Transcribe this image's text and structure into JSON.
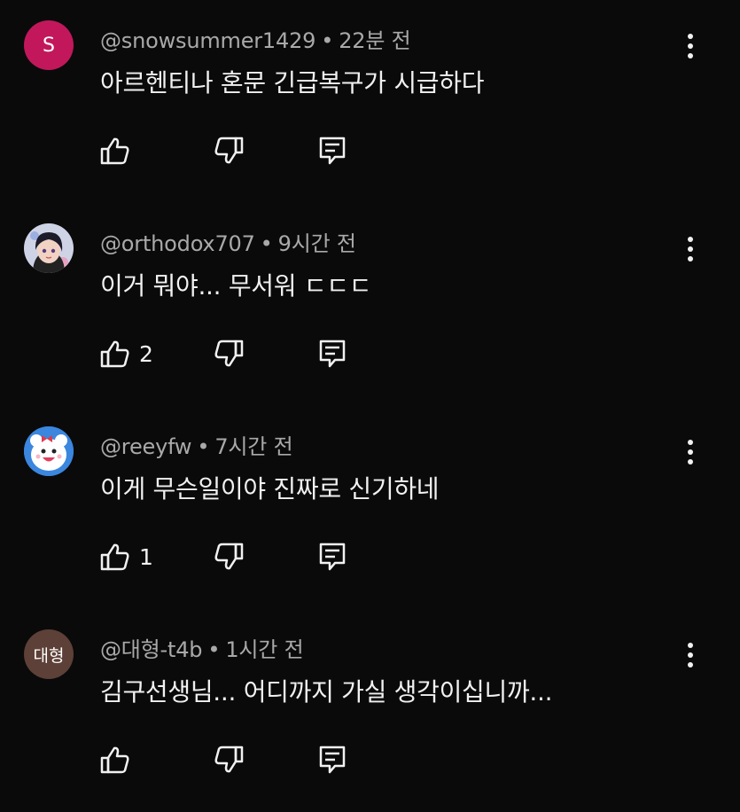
{
  "comments": [
    {
      "avatar": {
        "kind": "letter",
        "text": "S",
        "color": "#c2185b"
      },
      "author": "@snowsummer1429",
      "time": "22분 전",
      "text": "아르헨티나 혼문 긴급복구가 시급하다",
      "like_count": ""
    },
    {
      "avatar": {
        "kind": "image",
        "icon": "anime-girl-avatar"
      },
      "author": "@orthodox707",
      "time": "9시간 전",
      "text": "이거 뭐야... 무서워 ㄷㄷㄷ",
      "like_count": "2"
    },
    {
      "avatar": {
        "kind": "image",
        "icon": "cartoon-avatar"
      },
      "author": "@reeyfw",
      "time": "7시간 전",
      "text": "이게 무슨일이야 진짜로 신기하네",
      "like_count": "1"
    },
    {
      "avatar": {
        "kind": "text",
        "text": "대형",
        "color": "#5d4037"
      },
      "author": "@대형-t4b",
      "time": "1시간 전",
      "text": "김구선생님... 어디까지 가실 생각이십니까...",
      "like_count": ""
    }
  ],
  "icons": {
    "like": "thumbs-up-icon",
    "dislike": "thumbs-down-icon",
    "reply": "reply-icon",
    "more": "more-vert-icon"
  },
  "colors": {
    "background": "#0a0a0a",
    "text_primary": "#f1f1f1",
    "text_secondary": "#a9a9a9"
  }
}
